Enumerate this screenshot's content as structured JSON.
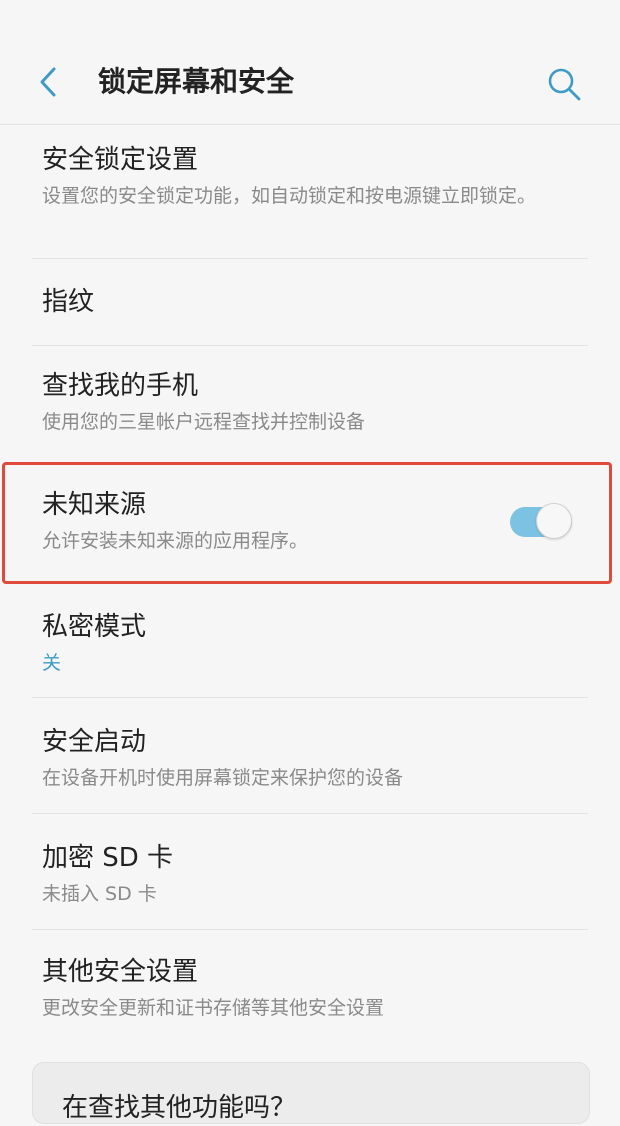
{
  "app_bar": {
    "title": "锁定屏幕和安全"
  },
  "icons": {
    "back": "chevron-left-icon",
    "search": "search-icon"
  },
  "colors": {
    "accent": "#3d9bc6",
    "toggle_on": "#7cc3e3",
    "highlight": "#e04a3a"
  },
  "items": [
    {
      "title": "安全锁定设置",
      "sub": "设置您的安全锁定功能，如自动锁定和按电源键立即锁定。"
    },
    {
      "title": "指纹",
      "sub": ""
    },
    {
      "title": "查找我的手机",
      "sub": "使用您的三星帐户远程查找并控制设备"
    },
    {
      "title": "未知来源",
      "sub": "允许安装未知来源的应用程序。",
      "toggle": true
    },
    {
      "title": "私密模式",
      "sub": "关"
    },
    {
      "title": "安全启动",
      "sub": "在设备开机时使用屏幕锁定来保护您的设备"
    },
    {
      "title": "加密 SD 卡",
      "sub": "未插入 SD 卡"
    },
    {
      "title": "其他安全设置",
      "sub": "更改安全更新和证书存储等其他安全设置"
    }
  ],
  "card": {
    "text": "在查找其他功能吗？"
  }
}
